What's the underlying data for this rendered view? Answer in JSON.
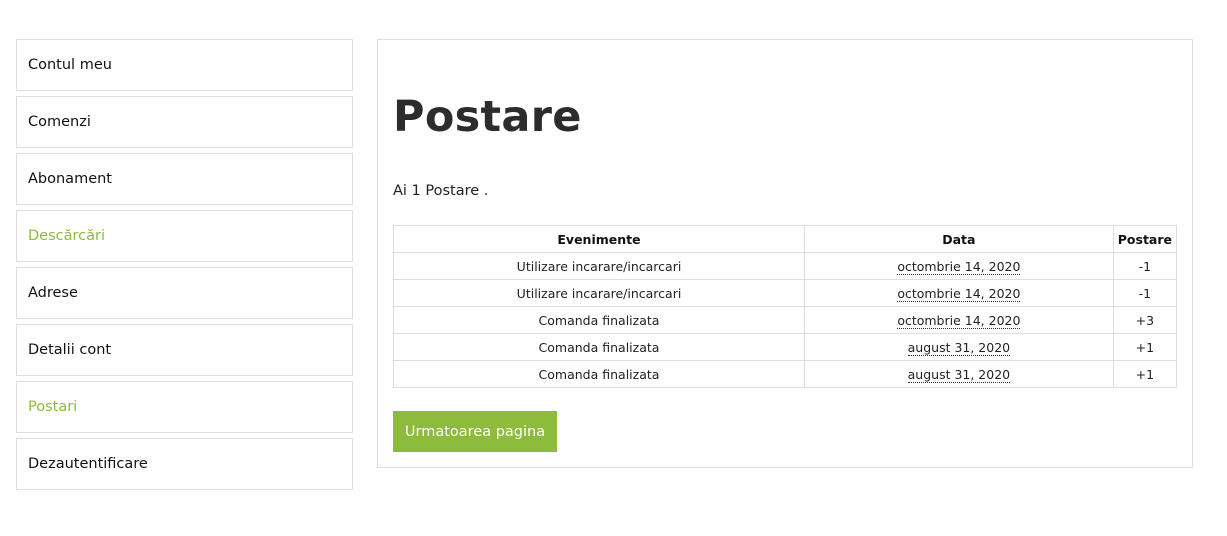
{
  "sidebar": {
    "items": [
      {
        "label": "Contul meu"
      },
      {
        "label": "Comenzi"
      },
      {
        "label": "Abonament"
      },
      {
        "label": "Descărcări"
      },
      {
        "label": "Adrese"
      },
      {
        "label": "Detalii cont"
      },
      {
        "label": "Postari"
      },
      {
        "label": "Dezautentificare"
      }
    ]
  },
  "main": {
    "title": "Postare",
    "summary": "Ai 1 Postare .",
    "table": {
      "headers": [
        "Evenimente",
        "Data",
        "Postare"
      ],
      "rows": [
        [
          "Utilizare incarare/incarcari",
          "octombrie 14, 2020",
          "-1"
        ],
        [
          "Utilizare incarare/incarcari",
          "octombrie 14, 2020",
          "-1"
        ],
        [
          "Comanda finalizata",
          "octombrie 14, 2020",
          "+3"
        ],
        [
          "Comanda finalizata",
          "august 31, 2020",
          "+1"
        ],
        [
          "Comanda finalizata",
          "august 31, 2020",
          "+1"
        ]
      ]
    },
    "next_button": "Urmatoarea pagina"
  },
  "colors": {
    "accent": "#8dbb3c",
    "border": "#dedede",
    "text": "#222222"
  }
}
